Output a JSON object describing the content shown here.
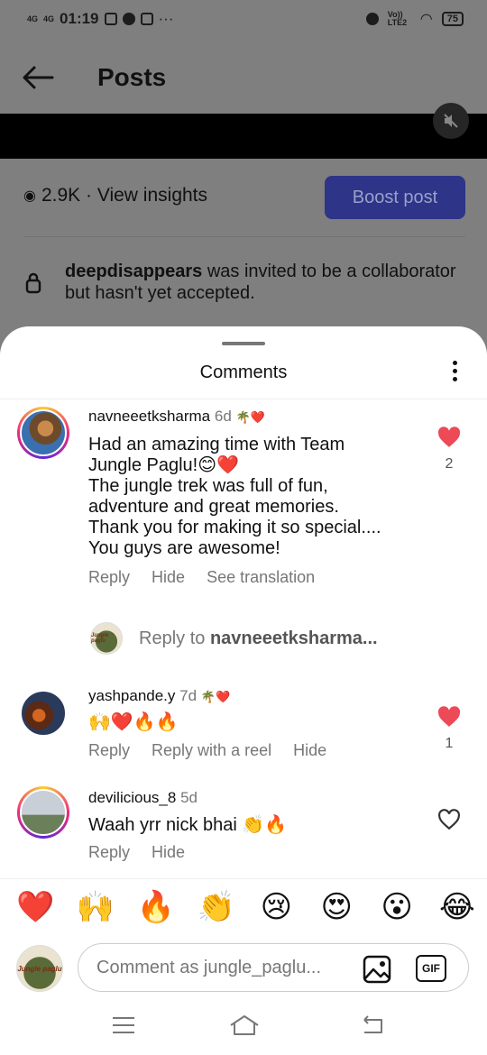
{
  "status_bar": {
    "net1": "4G",
    "net2": "4G",
    "time": "01:19",
    "dots": "···",
    "volte": "Vo)) LTE2",
    "battery": "75"
  },
  "header": {
    "title": "Posts"
  },
  "post": {
    "views": "2.9K · View insights",
    "boost_label": "Boost post",
    "collab_user": "deepdisappears",
    "collab_text": "was invited to be a collaborator but hasn't yet accepted."
  },
  "comments_sheet": {
    "title": "Comments",
    "comments": [
      {
        "username": "navneeetksharma",
        "time": "6d",
        "text_lines": [
          "Had an amazing time with Team",
          "Jungle Paglu!😊❤️",
          "The jungle trek was full of fun,",
          "adventure and great memories.",
          "Thank you for making it so special....",
          "You guys are awesome!"
        ],
        "actions": [
          "Reply",
          "Hide",
          "See translation"
        ],
        "likes": "2",
        "liked": true
      },
      {
        "username": "yashpande.y",
        "time": "7d",
        "text": "🙌❤️🔥🔥",
        "actions": [
          "Reply",
          "Reply with a reel",
          "Hide"
        ],
        "likes": "1",
        "liked": true
      },
      {
        "username": "devilicious_8",
        "time": "5d",
        "text": "Waah yrr nick bhai 👏🔥",
        "actions": [
          "Reply",
          "Hide"
        ],
        "likes": "",
        "liked": false
      }
    ],
    "reply_prompt_prefix": "Reply to",
    "reply_prompt_user": "navneeetksharma..."
  },
  "quick_reactions": [
    "❤️",
    "🙌",
    "🔥",
    "👏",
    "😢",
    "😍",
    "😮",
    "😂"
  ],
  "composer": {
    "placeholder": "Comment as jungle_paglu...",
    "gif_label": "GIF",
    "avatar_text": "Jungle paglu"
  },
  "colors": {
    "heart_red": "#ed4956",
    "boost_bg": "#2e3487",
    "muted_text": "#777777"
  }
}
